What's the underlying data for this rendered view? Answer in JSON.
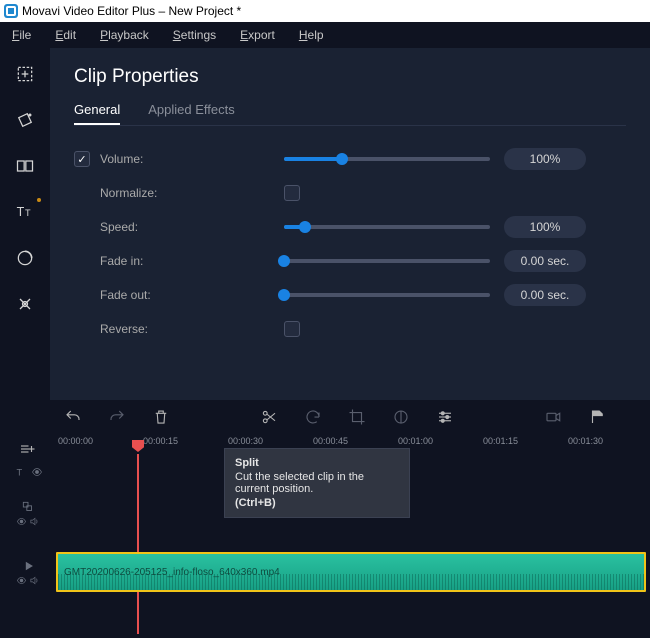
{
  "window": {
    "title": "Movavi Video Editor Plus – New Project *"
  },
  "menu": [
    "File",
    "Edit",
    "Playback",
    "Settings",
    "Export",
    "Help"
  ],
  "panel": {
    "title": "Clip Properties",
    "tabs": {
      "general": "General",
      "applied": "Applied Effects"
    }
  },
  "props": {
    "volume_label": "Volume:",
    "volume_value": "100%",
    "volume_pct": 28,
    "normalize_label": "Normalize:",
    "speed_label": "Speed:",
    "speed_value": "100%",
    "speed_pct": 10,
    "fadein_label": "Fade in:",
    "fadein_value": "0.00 sec.",
    "fadein_pct": 0,
    "fadeout_label": "Fade out:",
    "fadeout_value": "0.00 sec.",
    "fadeout_pct": 0,
    "reverse_label": "Reverse:"
  },
  "timeline": {
    "ticks": [
      "00:00:00",
      "00:00:15",
      "00:00:30",
      "00:00:45",
      "00:01:00",
      "00:01:15",
      "00:01:30"
    ],
    "clip_name": "GMT20200626-205125_info-floso_640x360.mp4"
  },
  "tooltip": {
    "title": "Split",
    "body": "Cut the selected clip in the current position.",
    "shortcut": "(Ctrl+B)"
  }
}
